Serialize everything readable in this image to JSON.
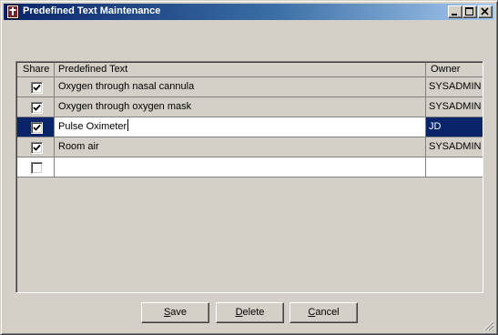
{
  "window": {
    "title": "Predefined Text Maintenance",
    "icon": "app-document-icon",
    "caption_buttons": [
      "minimize-icon",
      "maximize-icon",
      "close-icon"
    ]
  },
  "grid": {
    "columns": [
      "Share",
      "Predefined Text",
      "Owner"
    ],
    "rows": [
      {
        "share": true,
        "text": "Oxygen through nasal cannula",
        "owner": "SYSADMIN"
      },
      {
        "share": true,
        "text": "Oxygen through oxygen mask",
        "owner": "SYSADMIN"
      },
      {
        "share": true,
        "text": "Pulse Oximeter",
        "owner": "JD",
        "selected": true
      },
      {
        "share": true,
        "text": "Room air",
        "owner": "SYSADMIN"
      },
      {
        "share": false,
        "text": "",
        "owner": "",
        "new_row": true
      }
    ]
  },
  "buttons": {
    "save": {
      "mnemonic": "S",
      "rest": "ave"
    },
    "delete": {
      "mnemonic": "D",
      "rest": "elete"
    },
    "cancel": {
      "mnemonic": "C",
      "rest": "ancel"
    }
  },
  "colors": {
    "selection": "#0a246a",
    "face": "#d4d0c8",
    "title_gradient_start": "#0a246a",
    "title_gradient_end": "#a6caf0"
  }
}
